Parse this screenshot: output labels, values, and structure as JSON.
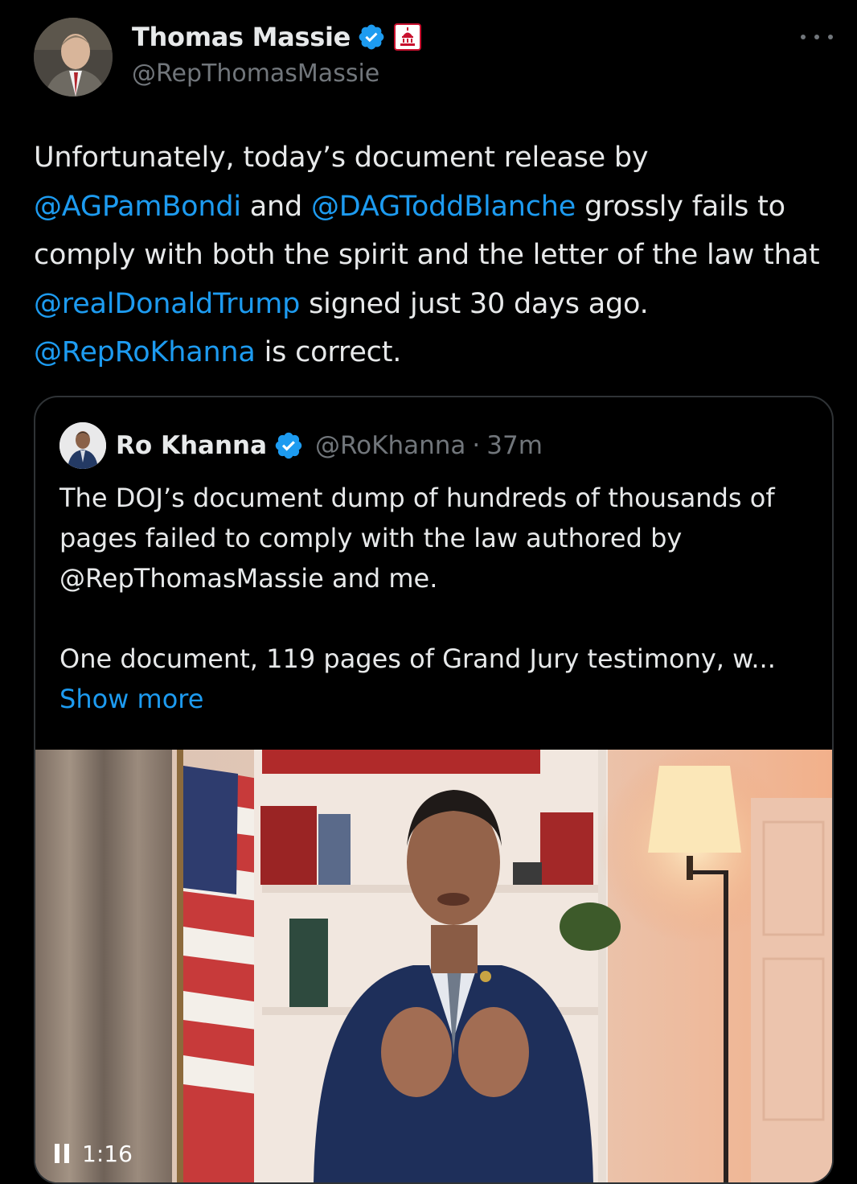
{
  "tweet": {
    "author": {
      "display_name": "Thomas Massie",
      "handle": "@RepThomasMassie"
    },
    "text_segments": [
      {
        "type": "text",
        "text": "Unfortunately, today’s document release by "
      },
      {
        "type": "mention",
        "text": "@AGPamBondi"
      },
      {
        "type": "text",
        "text": " and "
      },
      {
        "type": "mention",
        "text": "@DAGToddBlanche"
      },
      {
        "type": "text",
        "text": " grossly fails to comply with both the spirit and the letter of the law that "
      },
      {
        "type": "mention",
        "text": "@realDonaldTrump"
      },
      {
        "type": "text",
        "text": " signed just 30 days ago. "
      },
      {
        "type": "mention",
        "text": "@RepRoKhanna"
      },
      {
        "type": "text",
        "text": " is correct."
      }
    ],
    "quote": {
      "display_name": "Ro Khanna",
      "handle": "@RoKhanna",
      "separator": "·",
      "time": "37m",
      "paragraph_1": "The DOJ’s document dump of hundreds of thousands of pages failed to comply with the law authored by @RepThomasMassie and me.",
      "paragraph_2": "One document, 119 pages of Grand Jury testimony, w...",
      "show_more": "Show more",
      "video": {
        "elapsed": "1:16"
      }
    }
  },
  "icons": {
    "verified": "verified-badge-icon",
    "affiliation": "capitol-dome-icon",
    "more": "more-horizontal-icon",
    "pause": "pause-icon"
  },
  "colors": {
    "background": "#000000",
    "text": "#e7e9ea",
    "secondary": "#71767b",
    "link": "#1d9bf0",
    "border": "#2f3336",
    "verified": "#1d9bf0",
    "affiliation_red": "#c8102e"
  }
}
